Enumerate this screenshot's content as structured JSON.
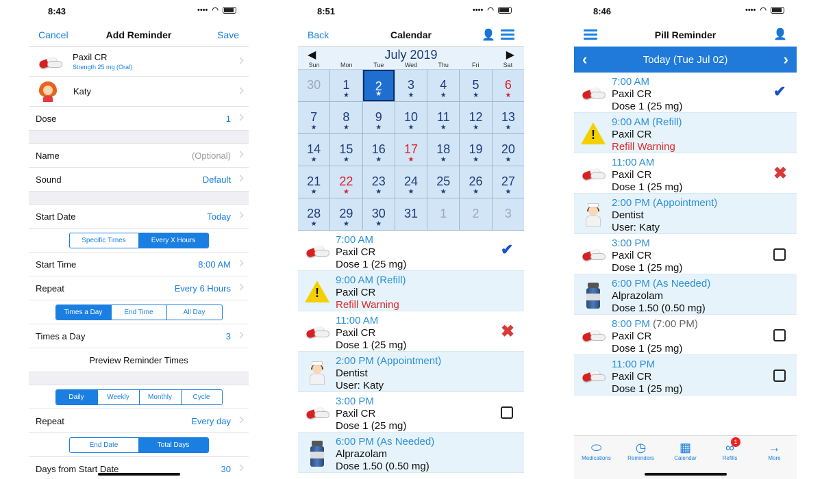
{
  "p1": {
    "time": "8:43",
    "nav": {
      "left": "Cancel",
      "title": "Add Reminder",
      "right": "Save"
    },
    "med": {
      "name": "Paxil CR",
      "strength": "Strength 25 mg (Oral)"
    },
    "person": "Katy",
    "dose": {
      "label": "Dose",
      "value": "1"
    },
    "name": {
      "label": "Name",
      "value": "(Optional)"
    },
    "sound": {
      "label": "Sound",
      "value": "Default"
    },
    "start_date": {
      "label": "Start Date",
      "value": "Today"
    },
    "seg1": [
      "Specific Times",
      "Every X Hours"
    ],
    "start_time": {
      "label": "Start Time",
      "value": "8:00 AM"
    },
    "repeat1": {
      "label": "Repeat",
      "value": "Every 6 Hours"
    },
    "seg2": [
      "Times a Day",
      "End Time",
      "All Day"
    ],
    "times_day": {
      "label": "Times a Day",
      "value": "3"
    },
    "preview": "Preview Reminder Times",
    "seg3": [
      "Daily",
      "Weekly",
      "Monthly",
      "Cycle"
    ],
    "repeat2": {
      "label": "Repeat",
      "value": "Every day"
    },
    "seg4": [
      "End Date",
      "Total Days"
    ],
    "days": {
      "label": "Days from Start Date",
      "value": "30"
    }
  },
  "p2": {
    "time": "8:51",
    "nav": {
      "left": "Back",
      "title": "Calendar"
    },
    "month": "July 2019",
    "dows": [
      "Sun",
      "Mon",
      "Tue",
      "Wed",
      "Thu",
      "Fri",
      "Sat"
    ],
    "days": [
      "30",
      "1",
      "2",
      "3",
      "4",
      "5",
      "6",
      "7",
      "8",
      "9",
      "10",
      "11",
      "12",
      "13",
      "14",
      "15",
      "16",
      "17",
      "18",
      "19",
      "20",
      "21",
      "22",
      "23",
      "24",
      "25",
      "26",
      "27",
      "28",
      "29",
      "30",
      "31",
      "1",
      "2",
      "3"
    ],
    "items": [
      {
        "t": "7:00 AM",
        "l2": "Paxil CR",
        "l3": "Dose 1 (25 mg)"
      },
      {
        "t": "9:00 AM (Refill)",
        "l2": "Paxil CR",
        "l3": "Refill Warning"
      },
      {
        "t": "11:00 AM",
        "l2": "Paxil CR",
        "l3": "Dose 1 (25 mg)"
      },
      {
        "t": "2:00 PM (Appointment)",
        "l2": "Dentist",
        "l3": "User: Katy"
      },
      {
        "t": "3:00 PM",
        "l2": "Paxil CR",
        "l3": "Dose 1 (25 mg)"
      },
      {
        "t": "6:00 PM (As Needed)",
        "l2": "Alprazolam",
        "l3": "Dose 1.50 (0.50 mg)"
      }
    ]
  },
  "p3": {
    "time": "8:46",
    "nav": {
      "title": "Pill Reminder"
    },
    "day": "Today (Tue Jul 02)",
    "items": [
      {
        "t": "7:00 AM",
        "l2": "Paxil CR",
        "l3": "Dose 1 (25 mg)"
      },
      {
        "t": "9:00 AM (Refill)",
        "l2": "Paxil CR",
        "l3": "Refill Warning"
      },
      {
        "t": "11:00 AM",
        "l2": "Paxil CR",
        "l3": "Dose 1 (25 mg)"
      },
      {
        "t": "2:00 PM (Appointment)",
        "l2": "Dentist",
        "l3": "User: Katy"
      },
      {
        "t": "3:00 PM",
        "l2": "Paxil CR",
        "l3": "Dose 1 (25 mg)"
      },
      {
        "t": "6:00 PM (As Needed)",
        "l2": "Alprazolam",
        "l3": "Dose 1.50 (0.50 mg)"
      },
      {
        "t": "8:00 PM",
        "tg": "(7:00 PM)",
        "l2": "Paxil CR",
        "l3": "Dose 1 (25 mg)"
      },
      {
        "t": "11:00 PM",
        "l2": "Paxil CR",
        "l3": "Dose 1 (25 mg)"
      }
    ],
    "tabs": [
      "Medications",
      "Reminders",
      "Calendar",
      "Refills",
      "More"
    ],
    "badge": "1"
  },
  "icons": {
    "check": "✔",
    "x": "✖",
    "warn": "!"
  }
}
